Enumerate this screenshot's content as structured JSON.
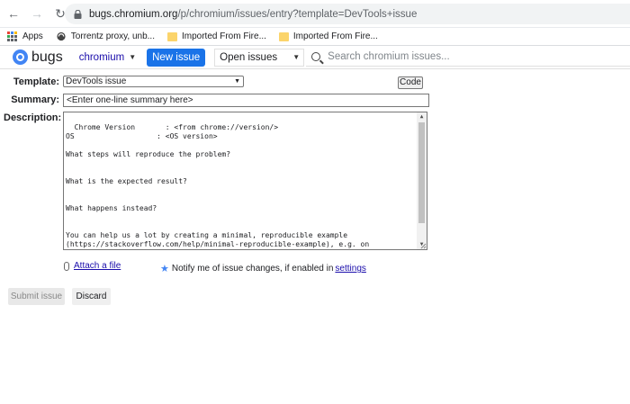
{
  "browser": {
    "url_host": "bugs.chromium.org",
    "url_path": "/p/chromium/issues/entry?template=DevTools+issue",
    "bookmarks": [
      {
        "label": "Apps",
        "icon": "apps-icon"
      },
      {
        "label": "Torrentz proxy, unb...",
        "icon": "site-icon"
      },
      {
        "label": "Imported From Fire...",
        "icon": "folder-icon"
      },
      {
        "label": "Imported From Fire...",
        "icon": "folder-icon"
      }
    ]
  },
  "header": {
    "logo_text": "bugs",
    "project": "chromium",
    "new_issue_label": "New issue",
    "scope": "Open issues",
    "search_placeholder": "Search chromium issues..."
  },
  "form": {
    "template_label": "Template:",
    "template_value": "DevTools issue",
    "code_label": "Code",
    "summary_label": "Summary:",
    "summary_placeholder": "<Enter one-line summary here>",
    "description_label": "Description:",
    "description_text": "Chrome Version       : <from chrome://version/>\nOS                   : <OS version>\n\nWhat steps will reproduce the problem?\n\n\nWhat is the expected result?\n\n\nWhat happens instead?\n\n\nYou can help us a lot by creating a minimal, reproducible example\n(https://stackoverflow.com/help/minimal-reproducible-example), e.g. on\nglitch.com, and/or attaching a screenshot or recording of the issue!",
    "attach_label": "Attach a file",
    "notify_text": "Notify me of issue changes, if enabled in ",
    "settings_link": "settings",
    "submit_label": "Submit issue",
    "discard_label": "Discard"
  },
  "colors": {
    "accent": "#1a73e8",
    "link": "#1a0dab",
    "star": "#4285f4"
  }
}
